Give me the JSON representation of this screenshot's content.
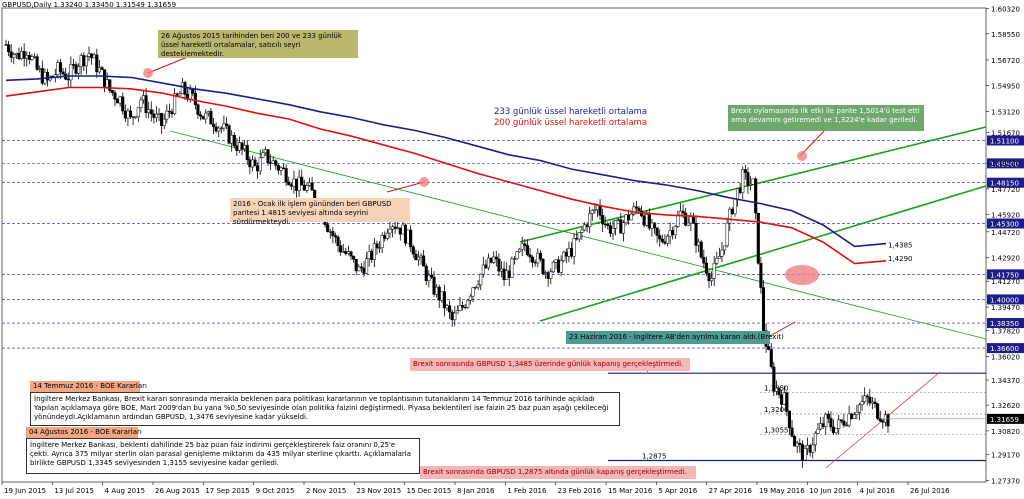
{
  "header": {
    "symbol_line": "GBPUSD,Daily  1.33240 1.33450 1.31549 1.31659"
  },
  "colors": {
    "ema233": "#1c1c8c",
    "ema200": "#e01010",
    "candles": "#000000",
    "levels": "#1c1c8c",
    "trend_green": "#1aa01a"
  },
  "chart_data": {
    "type": "candlestick",
    "y_range": [
      1.2725,
      1.6035
    ],
    "y_ticks": [
      "1.60320",
      "1.58550",
      "1.56720",
      "1.54950",
      "1.53120",
      "1.51670",
      "1.49520",
      "1.47720",
      "1.45920",
      "1.44720",
      "1.42920",
      "1.41270",
      "1.39470",
      "1.37820",
      "1.36020",
      "1.34370",
      "1.32620",
      "1.30820",
      "1.29170",
      "1.27370"
    ],
    "x_ticks": [
      "19 Jun 2015",
      "13 Jul 2015",
      "4 Aug 2015",
      "26 Aug 2015",
      "17 Sep 2015",
      "9 Oct 2015",
      "2 Nov 2015",
      "23 Nov 2015",
      "15 Dec 2015",
      "8 Jan 2016",
      "1 Feb 2016",
      "23 Feb 2016",
      "15 Mar 2016",
      "5 Apr 2016",
      "27 Apr 2016",
      "19 May 2016",
      "10 Jun 2016",
      "4 Jul 2016",
      "26 Jul 2016"
    ],
    "price_trace": [
      1.578,
      1.57,
      1.575,
      1.56,
      1.552,
      1.56,
      1.556,
      1.566,
      1.572,
      1.56,
      1.546,
      1.54,
      1.525,
      1.54,
      1.53,
      1.522,
      1.535,
      1.546,
      1.54,
      1.528,
      1.525,
      1.518,
      1.51,
      1.502,
      1.492,
      1.5,
      1.494,
      1.488,
      1.48,
      1.478,
      1.47,
      1.452,
      1.438,
      1.43,
      1.42,
      1.428,
      1.44,
      1.455,
      1.45,
      1.44,
      1.425,
      1.41,
      1.4,
      1.385,
      1.395,
      1.41,
      1.42,
      1.428,
      1.415,
      1.425,
      1.438,
      1.43,
      1.42,
      1.422,
      1.43,
      1.44,
      1.455,
      1.465,
      1.45,
      1.45,
      1.458,
      1.465,
      1.45,
      1.44,
      1.448,
      1.46,
      1.455,
      1.43,
      1.415,
      1.435,
      1.465,
      1.485,
      1.48,
      1.38,
      1.34,
      1.33,
      1.3,
      1.29,
      1.305,
      1.315,
      1.31,
      1.318,
      1.325,
      1.33,
      1.322,
      1.316
    ],
    "ema233_trace": [
      1.553,
      1.554,
      1.556,
      1.556,
      1.555,
      1.551,
      1.547,
      1.544,
      1.54,
      1.536,
      1.531,
      1.527,
      1.522,
      1.518,
      1.513,
      1.507,
      1.501,
      1.497,
      1.491,
      1.487,
      1.483,
      1.48,
      1.476,
      1.471,
      1.467,
      1.462,
      1.452,
      1.437,
      1.439
    ],
    "ema200_trace": [
      1.542,
      1.545,
      1.548,
      1.548,
      1.547,
      1.544,
      1.539,
      1.535,
      1.53,
      1.526,
      1.519,
      1.514,
      1.508,
      1.502,
      1.495,
      1.488,
      1.482,
      1.476,
      1.47,
      1.465,
      1.461,
      1.459,
      1.458,
      1.456,
      1.454,
      1.45,
      1.44,
      1.425,
      1.427
    ],
    "horizontal_levels": [
      {
        "price": 1.511,
        "label": "1.51100"
      },
      {
        "price": 1.495,
        "label": "1.49500"
      },
      {
        "price": 1.4815,
        "label": "1.48150"
      },
      {
        "price": 1.453,
        "label": "1.45300"
      },
      {
        "price": 1.4175,
        "label": "1.41750"
      },
      {
        "price": 1.4,
        "label": "1.40000"
      },
      {
        "price": 1.3835,
        "label": "1.38350"
      },
      {
        "price": 1.366,
        "label": "1.36600"
      }
    ],
    "sr_levels": [
      {
        "price": 1.3485,
        "label": "1,3485"
      },
      {
        "price": 1.335,
        "label": "1,3350"
      },
      {
        "price": 1.32,
        "label": "1,3200"
      },
      {
        "price": 1.3055,
        "label": "1,3055"
      },
      {
        "price": 1.2875,
        "label": "1,2875"
      }
    ],
    "right_labels": [
      {
        "price": 1.4385,
        "text": "1,4385"
      },
      {
        "price": 1.429,
        "text": "1,4290"
      }
    ],
    "current_price": "1.31659"
  },
  "legend": {
    "ema233": "233 günlük üssel hareketli ortalama",
    "ema200": "200 günlük üssel hareketli ortalama"
  },
  "annotations": {
    "aug2015": "26 Ağustos 2015 tarihinden beri 200 ve 233 günlük üssel hareketli ortalamalar, satıcılı seyri desteklemektedir.",
    "jan2016": "2016 - Ocak ilk işlem gününden beri GBPUSD paritesi 1.4815 seviyesi altında seyrini sürdürmekteydi.",
    "brexit_poll": "Brexit oylamasında ilk etki ile parite 1,5014'ü test etti ama devamını getiremedi ve 1,3224'e kadar geriledi.",
    "brexit_vote": "23 Haziran 2016 - İngiltere AB'den ayrılma kararı aldı.(Brexit)",
    "close_above": "Brexit sonrasında GBPUSD 1,3485 üzerinde günlük kapanış  gerçekleştirmedi.",
    "close_below": "Brexit sonrasında GBPUSD 1,2875 altında günlük kapanış  gerçekleştirmedi.",
    "boe_jul_title": "14 Temmuz 2016 - BOE Kararları",
    "boe_jul_text": "İngiltere Merkez Bankası, Brexit kararı sonrasında merakla beklenen para politikası kararlarının ve toplantısının tutanaklarını 14 Temmuz 2016 tarihinde açıkladı Yapılan açıklamaya göre BOE, Mart 2009'dan bu yana %0,50 seviyesinde olan politika faizini değiştirmedi. Piyasa beklentileri ise faizin 25 baz puan aşağı çekileceği yönündeydi.Açıklamanın ardından GBPUSD, 1,3476 seviyesine kadar  yükseldi.",
    "boe_aug_title": "04 Ağustos 2016 - BOE Kararları",
    "boe_aug_text": "İngiltere Merkez Bankası, beklenti dahilinde 25 baz puan faiz  indirimi gerçekleştirerek faiz oranını 0,25'e çekti. Ayrıca 375 milyar sterlin olan parasal genişleme miktarını da 435  milyar sterline çıkarttı. Açıklamalarla birlikte GBPUSD 1,3345 seviyesinden 1,3155 seviyesine kadar geriledi."
  }
}
